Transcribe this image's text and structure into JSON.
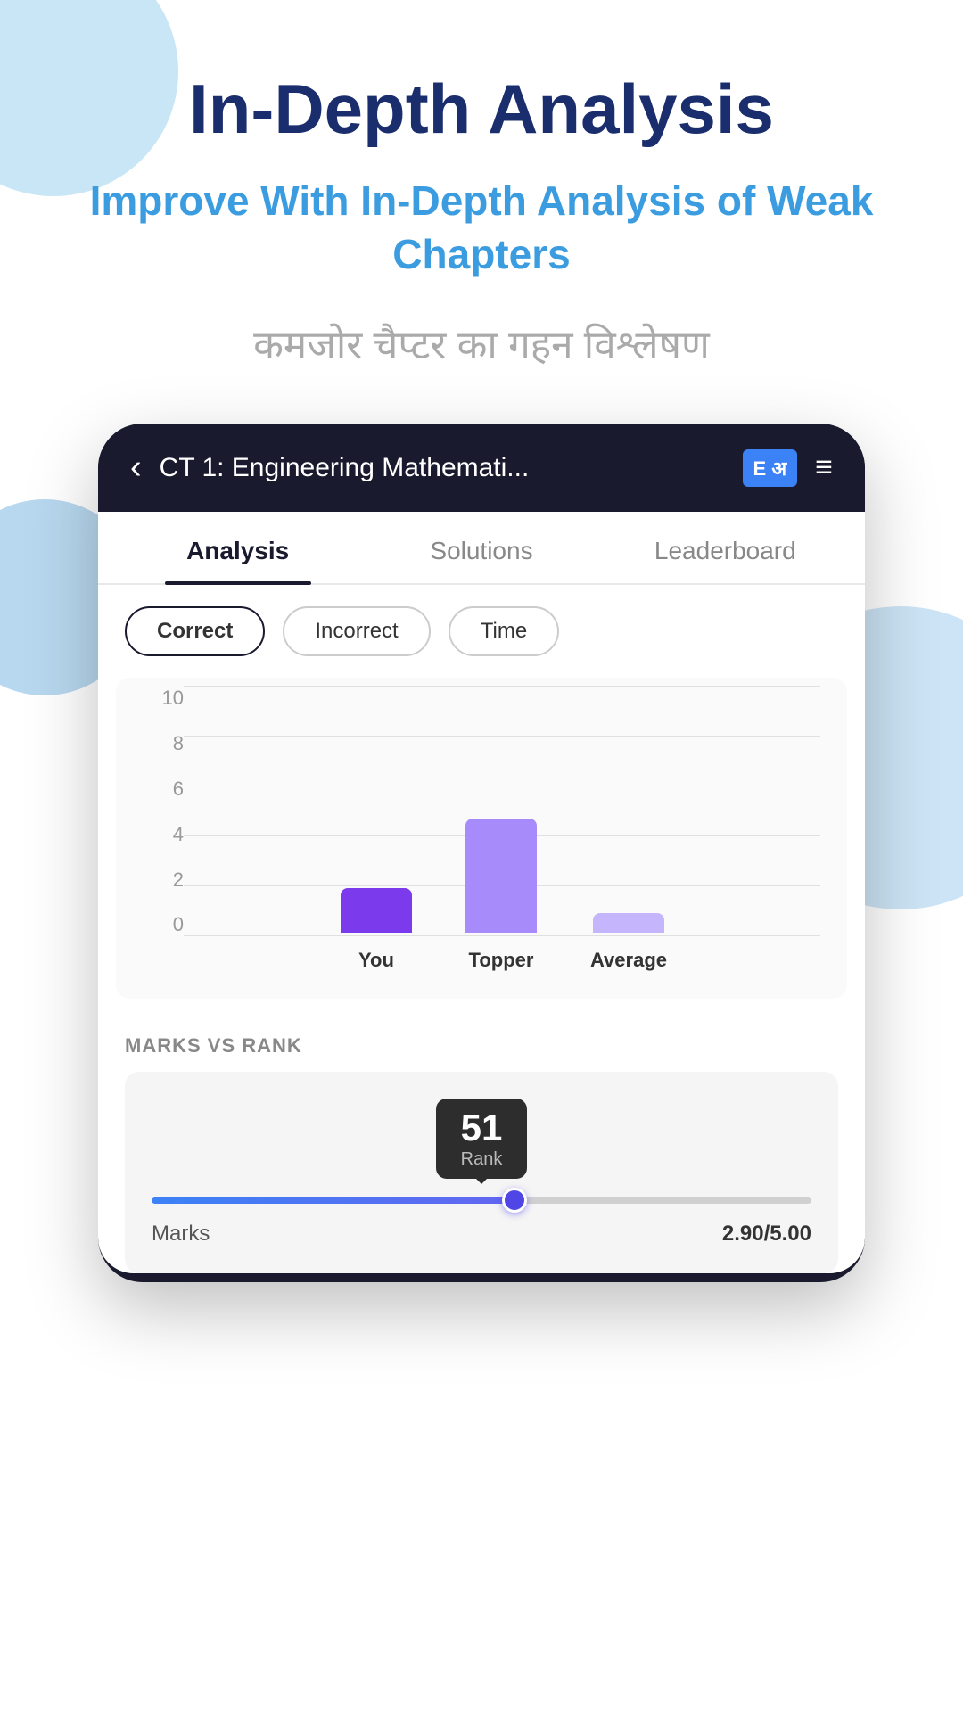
{
  "page": {
    "main_title": "In-Depth Analysis",
    "subtitle": "Improve With In-Depth Analysis of Weak Chapters",
    "hindi_text": "कमजोर चैप्टर का गहन विश्लेषण"
  },
  "header": {
    "back_icon": "‹",
    "title": "CT 1: Engineering Mathemati...",
    "edu_icon": "E अ",
    "menu_icon": "≡"
  },
  "tabs": [
    {
      "label": "Analysis",
      "active": true
    },
    {
      "label": "Solutions",
      "active": false
    },
    {
      "label": "Leaderboard",
      "active": false
    }
  ],
  "filters": [
    {
      "label": "Correct",
      "active": true
    },
    {
      "label": "Incorrect",
      "active": false
    },
    {
      "label": "Time",
      "active": false
    }
  ],
  "chart": {
    "y_labels": [
      "0",
      "2",
      "4",
      "6",
      "8",
      "10"
    ],
    "bars": [
      {
        "label": "You",
        "value": 1.8,
        "max": 10,
        "type": "you"
      },
      {
        "label": "Topper",
        "value": 4.6,
        "max": 10,
        "type": "topper"
      },
      {
        "label": "Average",
        "value": 0.8,
        "max": 10,
        "type": "average"
      }
    ]
  },
  "marks_vs_rank": {
    "section_title": "MARKS VS RANK",
    "rank_number": "51",
    "rank_label": "Rank",
    "slider_percent": 55,
    "marks_label": "Marks",
    "marks_value": "2.90/5.00"
  }
}
